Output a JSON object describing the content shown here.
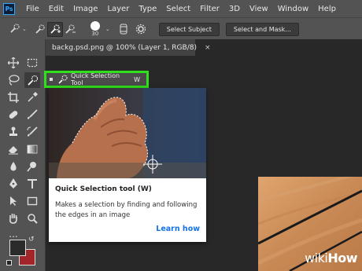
{
  "app": {
    "logo": "Ps"
  },
  "menu": [
    "File",
    "Edit",
    "Image",
    "Layer",
    "Type",
    "Select",
    "Filter",
    "3D",
    "View",
    "Window",
    "Help"
  ],
  "options": {
    "brush_size": "30",
    "select_subject": "Select Subject",
    "select_and_mask": "Select and Mask..."
  },
  "document": {
    "tab_title": "backg.psd.png @ 100% (Layer 1, RGB/8)",
    "close_glyph": "×"
  },
  "tool_tip": {
    "label": "Quick Selection Tool",
    "shortcut": "W"
  },
  "popup": {
    "title": "Quick Selection tool (W)",
    "description": "Makes a selection by finding and following the edges in an image",
    "link": "Learn how"
  },
  "toolbar": {
    "more": "..."
  },
  "watermark": {
    "wiki": "wiki",
    "how": "How"
  },
  "colors": {
    "accent": "#1473e6",
    "highlight": "#2ee11a",
    "foreground": "#2b2b2b",
    "background": "#a3252a"
  }
}
